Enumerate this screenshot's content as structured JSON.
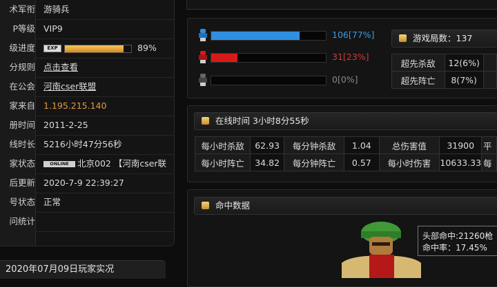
{
  "left_panel": {
    "rows": [
      {
        "label": "术军衔",
        "value": "游骑兵"
      },
      {
        "label": "P等级",
        "value": "VIP9"
      },
      {
        "label": "级进度",
        "exp_badge": "EXP",
        "progress": 0.89,
        "value": "89%"
      },
      {
        "label": "分规则",
        "value": "点击查看"
      },
      {
        "label": "在公会",
        "value": "河南cser联盟"
      },
      {
        "label": "家来自",
        "value": "1.195.215.140"
      },
      {
        "label": "册时间",
        "value": "2011-2-25"
      },
      {
        "label": "线时长",
        "value": "5216小时47分56秒"
      },
      {
        "label": "家状态",
        "online_badge": "ONLINE",
        "value": "北京002 【河南cser联"
      },
      {
        "label": "后更新",
        "value": "2020-7-9 22:39:27"
      },
      {
        "label": "号状态",
        "value": "正常"
      },
      {
        "label": "问统计",
        "value": ""
      }
    ]
  },
  "bottom_bar": {
    "text": "2020年07月09日玩家实况"
  },
  "team_bars": [
    {
      "color": "#2f8fe0",
      "ratio": 0.77,
      "text": "106[77%]",
      "text_color": "#3a9de8",
      "icon": "blue-soldier-icon"
    },
    {
      "color": "#d61a1a",
      "ratio": 0.23,
      "text": "31[23%]",
      "text_color": "#d23a3a",
      "icon": "red-soldier-icon"
    },
    {
      "color": "#444444",
      "ratio": 0,
      "text": "0[0%]",
      "text_color": "#8a8a8a",
      "icon": "gray-soldier-icon"
    }
  ],
  "games": {
    "title": "游戏局数：137",
    "rows": [
      {
        "label": "超先杀敌",
        "value": "12(6%)"
      },
      {
        "label": "超先阵亡",
        "value": "8(7%)"
      }
    ]
  },
  "online": {
    "title": "在线时间 3小时8分55秒",
    "rows": [
      {
        "c1": "每小时杀敌",
        "v1": "62.93",
        "c2": "每分钟杀敌",
        "v2": "1.04",
        "c3": "总伤害值",
        "v3": "31900",
        "c4": "平"
      },
      {
        "c1": "每小时阵亡",
        "v1": "34.82",
        "c2": "每分钟阵亡",
        "v2": "0.57",
        "c3": "每小时伤害",
        "v3": "10633.33",
        "c4": "每"
      }
    ]
  },
  "hits": {
    "title": "命中数据",
    "tooltip_line1": "头部命中:21260枪",
    "tooltip_line2": "命中率：17.45%"
  }
}
